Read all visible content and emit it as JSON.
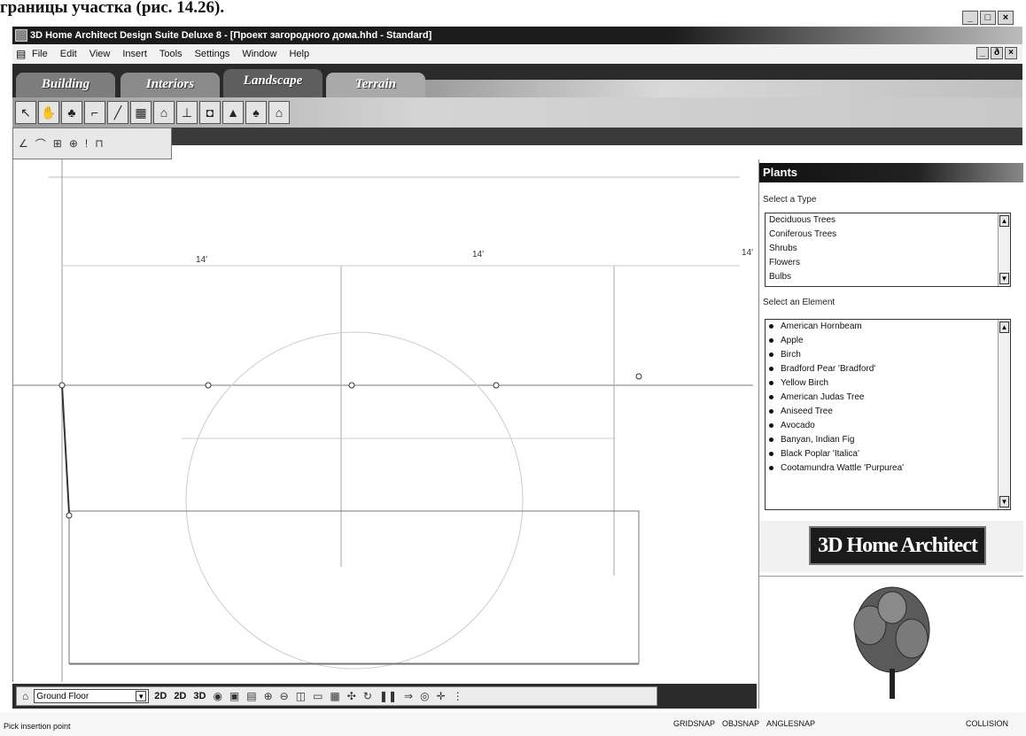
{
  "caption": "границы участка (рис. 14.26).",
  "window": {
    "title": "3D Home Architect Design Suite Deluxe 8 - [Проект загородного дома.hhd - Standard]",
    "buttons": {
      "minimize": "_",
      "maximize": "□",
      "close": "×"
    },
    "mdi_buttons": {
      "minimize": "_",
      "restore": "ð",
      "close": "×"
    }
  },
  "menu": [
    "File",
    "Edit",
    "View",
    "Insert",
    "Tools",
    "Settings",
    "Window",
    "Help"
  ],
  "tabs": [
    {
      "label": "Building",
      "active": false
    },
    {
      "label": "Interiors",
      "active": false
    },
    {
      "label": "Landscape",
      "active": true
    },
    {
      "label": "Terrain",
      "active": false
    }
  ],
  "toolbar1_icons": [
    "pointer-icon",
    "hand-icon",
    "plant-icon",
    "path-icon",
    "fence-icon",
    "deck-icon",
    "gazebo-icon",
    "post-icon",
    "pool-icon",
    "rock-icon",
    "tree-icon",
    "house-icon"
  ],
  "toolbar2_icons": [
    "line-icon",
    "arc-icon",
    "grid-icon",
    "snap-icon",
    "marker-icon",
    "ruler-icon"
  ],
  "canvas": {
    "dimensions": [
      "14'",
      "14'",
      "14'"
    ]
  },
  "panel": {
    "title": "Plants",
    "type_label": "Select a Type",
    "types": [
      "Deciduous Trees",
      "Coniferous Trees",
      "Shrubs",
      "Flowers",
      "Bulbs"
    ],
    "element_label": "Select an Element",
    "elements": [
      "American Hornbeam",
      "Apple",
      "Birch",
      "Bradford Pear 'Bradford'",
      "Yellow Birch",
      "American Judas Tree",
      "Aniseed Tree",
      "Avocado",
      "Banyan, Indian Fig",
      "Black Poplar 'Italica'",
      "Cootamundra Wattle 'Purpurea'"
    ],
    "brand": "3D Home Architect"
  },
  "bottom_toolbar": {
    "floor": "Ground Floor",
    "view_buttons": [
      "2D",
      "2D",
      "3D"
    ]
  },
  "status": {
    "text": "Pick insertion point",
    "snaps": [
      "GRIDSNAP",
      "OBJSNAP",
      "ANGLESNAP"
    ],
    "collision": "COLLISION"
  }
}
